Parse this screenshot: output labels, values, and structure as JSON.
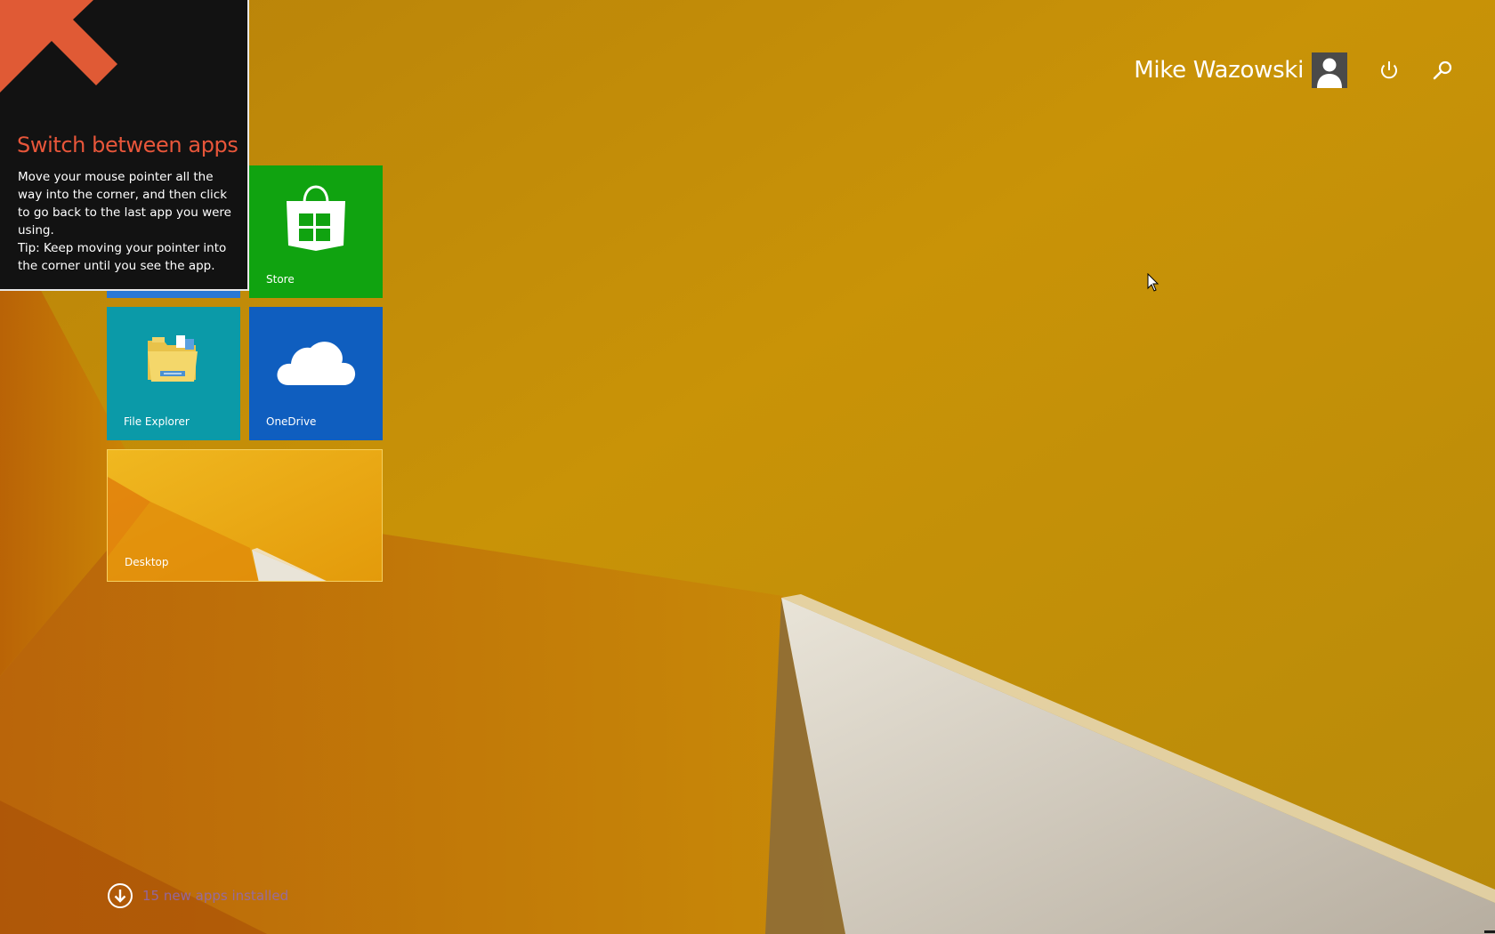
{
  "screen": {
    "name": "Windows Start screen",
    "background_color": "#c98a05"
  },
  "user": {
    "name": "Mike Wazowski",
    "avatar_icon": "user-silhouette-icon",
    "power_icon": "power-icon",
    "search_icon": "search-icon"
  },
  "tiles": [
    {
      "id": "hidden",
      "label": "",
      "color": "#2a78d4"
    },
    {
      "id": "store",
      "label": "Store",
      "color": "#10a310",
      "icon": "store-bag-icon"
    },
    {
      "id": "file-explorer",
      "label": "File Explorer",
      "color": "#0b9aa8",
      "icon": "folder-icon"
    },
    {
      "id": "onedrive",
      "label": "OneDrive",
      "color": "#0f5ebf",
      "icon": "cloud-icon"
    },
    {
      "id": "desktop",
      "label": "Desktop",
      "color": "#e7a80d"
    }
  ],
  "tip": {
    "title": "Switch between apps",
    "body_line1": "Move your mouse pointer all the way into the corner, and then click to go back to the last app you were using.",
    "body_line2": "Tip: Keep moving your pointer into the corner until you see the app.",
    "arrow_icon": "corner-arrow-icon",
    "title_color": "#e8563a",
    "arrow_color": "#e05a35"
  },
  "notification": {
    "label": "15 new apps installed",
    "icon": "down-arrow-icon"
  }
}
